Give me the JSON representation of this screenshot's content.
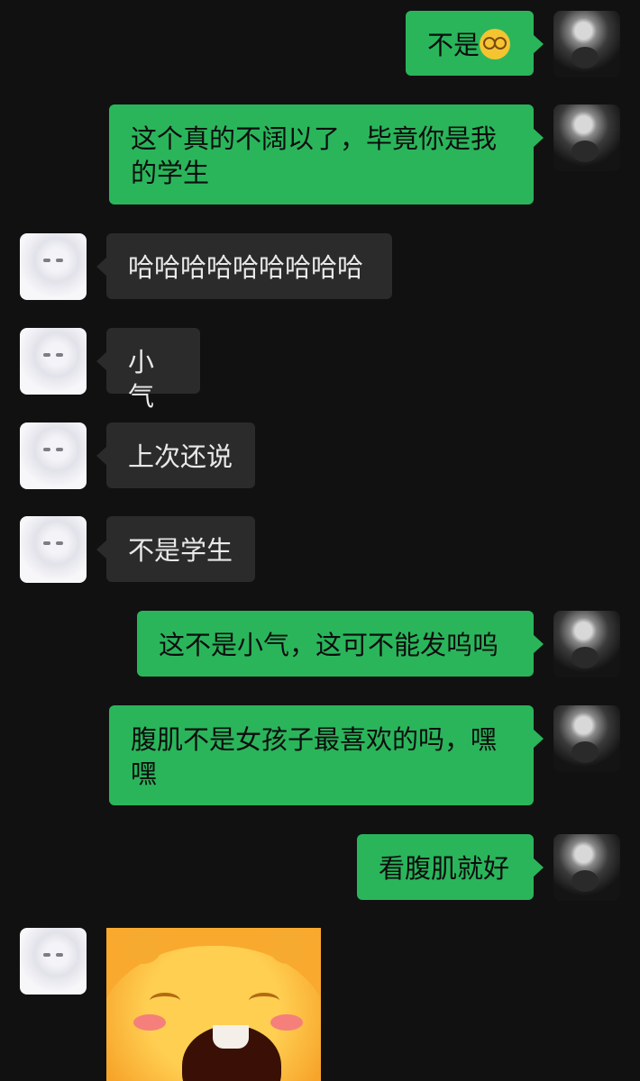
{
  "messages": [
    {
      "side": "mine",
      "text": "不是",
      "emoji": "dizzy-face-emoji"
    },
    {
      "side": "mine",
      "text": "这个真的不阔以了，毕竟你是我的学生"
    },
    {
      "side": "theirs",
      "text": "哈哈哈哈哈哈哈哈哈"
    },
    {
      "side": "theirs",
      "text": "小气"
    },
    {
      "side": "theirs",
      "text": "上次还说"
    },
    {
      "side": "theirs",
      "text": "不是学生"
    },
    {
      "side": "mine",
      "text": "这不是小气，这可不能发呜呜"
    },
    {
      "side": "mine",
      "text": "腹肌不是女孩子最喜欢的吗，嘿嘿"
    },
    {
      "side": "mine",
      "text": "看腹肌就好"
    },
    {
      "side": "theirs",
      "sticker": "laughing-orange-hippo-sticker"
    }
  ],
  "colors": {
    "background": "#111111",
    "mine_bubble": "#2ab55b",
    "theirs_bubble": "#2b2b2b"
  }
}
